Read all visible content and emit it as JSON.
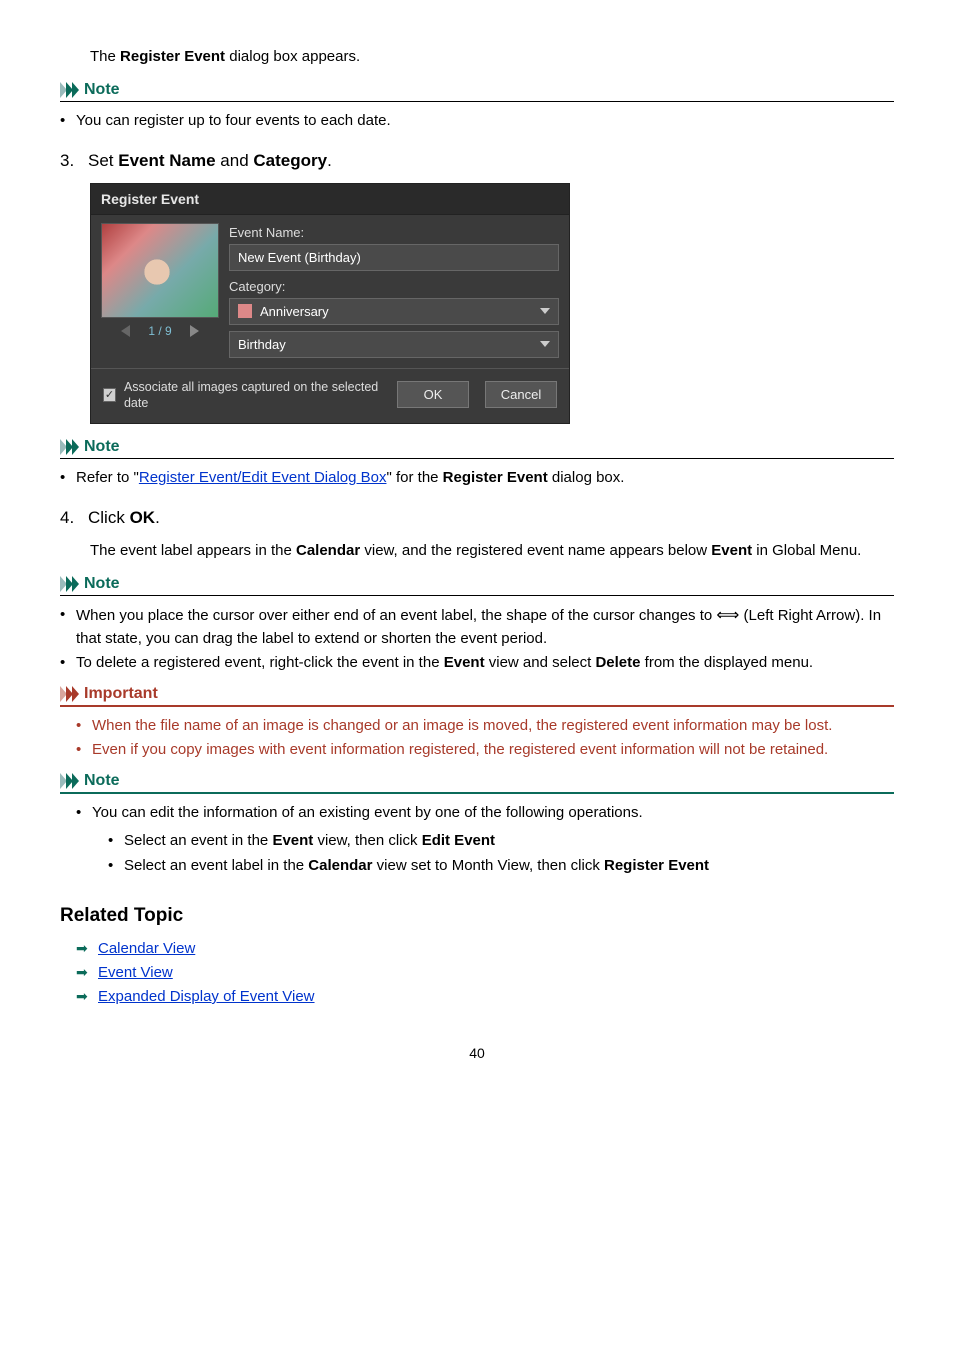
{
  "intro_prefix": "The ",
  "intro_bold": "Register Event",
  "intro_suffix": " dialog box appears.",
  "note_label": "Note",
  "important_label": "Important",
  "note1_item": "You can register up to four events to each date.",
  "step3_num": "3.",
  "step3_prefix": "Set ",
  "step3_b1": "Event Name",
  "step3_mid": " and ",
  "step3_b2": "Category",
  "step3_suffix": ".",
  "dialog": {
    "title": "Register Event",
    "event_name_label": "Event Name:",
    "event_name_value": "New Event (Birthday)",
    "category_label": "Category:",
    "category_value": "Anniversary",
    "subcategory_value": "Birthday",
    "counter": "1 / 9",
    "checkbox_text": "Associate all images captured on the selected date",
    "ok": "OK",
    "cancel": "Cancel"
  },
  "note2_prefix": "Refer to \"",
  "note2_link": "Register Event/Edit Event Dialog Box",
  "note2_mid": "\" for the ",
  "note2_bold": "Register Event",
  "note2_suffix": " dialog box.",
  "step4_num": "4.",
  "step4_prefix": "Click ",
  "step4_bold": "OK",
  "step4_suffix": ".",
  "step4_para_a": "The event label appears in the ",
  "step4_para_b1": "Calendar",
  "step4_para_b": " view, and the registered event name appears below ",
  "step4_para_b2": "Event",
  "step4_para_c": " in Global Menu.",
  "note3_item1_a": "When you place the cursor over either end of an event label, the shape of the cursor changes to ",
  "note3_item1_b": " (Left Right Arrow). In that state, you can drag the label to extend or shorten the event period.",
  "note3_item2_a": "To delete a registered event, right-click the event in the ",
  "note3_item2_b1": "Event",
  "note3_item2_b": " view and select ",
  "note3_item2_b2": "Delete",
  "note3_item2_c": " from the displayed menu.",
  "important_item1": "When the file name of an image is changed or an image is moved, the registered event information may be lost.",
  "important_item2": "Even if you copy images with event information registered, the registered event information will not be retained.",
  "note4_lead": "You can edit the information of an existing event by one of the following operations.",
  "note4_s1_a": "Select an event in the ",
  "note4_s1_b1": "Event",
  "note4_s1_b": " view, then click ",
  "note4_s1_b2": "Edit Event",
  "note4_s2_a": "Select an event label in the ",
  "note4_s2_b1": "Calendar",
  "note4_s2_b": " view set to Month View, then click ",
  "note4_s2_b2": "Register Event",
  "related_heading": "Related Topic",
  "related_links": {
    "l1": "Calendar View",
    "l2": "Event View",
    "l3": "Expanded Display of Event View"
  },
  "page_number": "40"
}
